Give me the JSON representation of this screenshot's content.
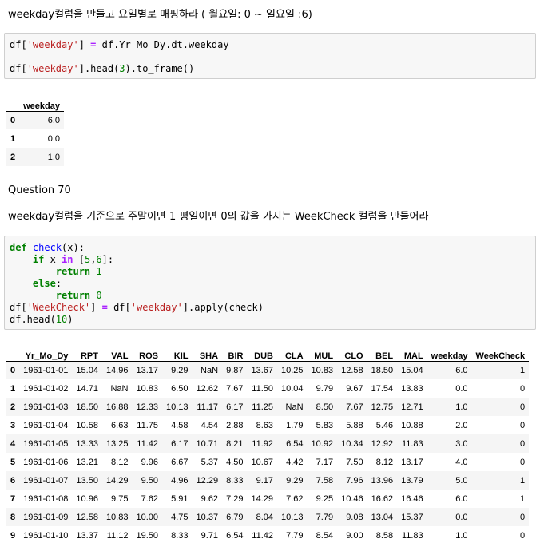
{
  "md1": "weekday컬럼을 만들고 요일별로 매핑하라 ( 월요일: 0 ~ 일요일 :6)",
  "cell1": {
    "line1": [
      {
        "t": "df[",
        "c": ""
      },
      {
        "t": "'weekday'",
        "c": "str"
      },
      {
        "t": "] ",
        "c": ""
      },
      {
        "t": "=",
        "c": "op"
      },
      {
        "t": " df.Yr_Mo_Dy.dt.weekday",
        "c": ""
      }
    ],
    "line2": [
      {
        "t": "df[",
        "c": ""
      },
      {
        "t": "'weekday'",
        "c": "str"
      },
      {
        "t": "].head(",
        "c": ""
      },
      {
        "t": "3",
        "c": "num"
      },
      {
        "t": ").to_frame()",
        "c": ""
      }
    ]
  },
  "table1": {
    "columns": [
      "weekday"
    ],
    "rows": [
      {
        "index": "0",
        "values": [
          "6.0"
        ]
      },
      {
        "index": "1",
        "values": [
          "0.0"
        ]
      },
      {
        "index": "2",
        "values": [
          "1.0"
        ]
      }
    ]
  },
  "question": "Question 70",
  "md2": "weekday컬럼을 기준으로 주말이면 1 평일이면 0의 값을 가지는 WeekCheck 컬럼을 만들어라",
  "cell2": {
    "lines": [
      [
        {
          "t": "def",
          "c": "kw"
        },
        {
          "t": " ",
          "c": ""
        },
        {
          "t": "check",
          "c": "fn"
        },
        {
          "t": "(x):",
          "c": ""
        }
      ],
      [
        {
          "t": "    ",
          "c": ""
        },
        {
          "t": "if",
          "c": "kw"
        },
        {
          "t": " x ",
          "c": ""
        },
        {
          "t": "in",
          "c": "op"
        },
        {
          "t": " [",
          "c": ""
        },
        {
          "t": "5",
          "c": "num"
        },
        {
          "t": ",",
          "c": ""
        },
        {
          "t": "6",
          "c": "num"
        },
        {
          "t": "]:",
          "c": ""
        }
      ],
      [
        {
          "t": "        ",
          "c": ""
        },
        {
          "t": "return",
          "c": "kw"
        },
        {
          "t": " ",
          "c": ""
        },
        {
          "t": "1",
          "c": "num"
        }
      ],
      [
        {
          "t": "    ",
          "c": ""
        },
        {
          "t": "else",
          "c": "kw"
        },
        {
          "t": ":",
          "c": ""
        }
      ],
      [
        {
          "t": "        ",
          "c": ""
        },
        {
          "t": "return",
          "c": "kw"
        },
        {
          "t": " ",
          "c": ""
        },
        {
          "t": "0",
          "c": "num"
        }
      ],
      [
        {
          "t": "df[",
          "c": ""
        },
        {
          "t": "'WeekCheck'",
          "c": "str"
        },
        {
          "t": "] ",
          "c": ""
        },
        {
          "t": "=",
          "c": "op"
        },
        {
          "t": " df[",
          "c": ""
        },
        {
          "t": "'weekday'",
          "c": "str"
        },
        {
          "t": "].apply(check)",
          "c": ""
        }
      ],
      [
        {
          "t": "df.head(",
          "c": ""
        },
        {
          "t": "10",
          "c": "num"
        },
        {
          "t": ")",
          "c": ""
        }
      ]
    ]
  },
  "table2": {
    "columns": [
      "Yr_Mo_Dy",
      "RPT",
      "VAL",
      "ROS",
      "KIL",
      "SHA",
      "BIR",
      "DUB",
      "CLA",
      "MUL",
      "CLO",
      "BEL",
      "MAL",
      "weekday",
      "WeekCheck"
    ],
    "rows": [
      {
        "index": "0",
        "values": [
          "1961-01-01",
          "15.04",
          "14.96",
          "13.17",
          "9.29",
          "NaN",
          "9.87",
          "13.67",
          "10.25",
          "10.83",
          "12.58",
          "18.50",
          "15.04",
          "6.0",
          "1"
        ]
      },
      {
        "index": "1",
        "values": [
          "1961-01-02",
          "14.71",
          "NaN",
          "10.83",
          "6.50",
          "12.62",
          "7.67",
          "11.50",
          "10.04",
          "9.79",
          "9.67",
          "17.54",
          "13.83",
          "0.0",
          "0"
        ]
      },
      {
        "index": "2",
        "values": [
          "1961-01-03",
          "18.50",
          "16.88",
          "12.33",
          "10.13",
          "11.17",
          "6.17",
          "11.25",
          "NaN",
          "8.50",
          "7.67",
          "12.75",
          "12.71",
          "1.0",
          "0"
        ]
      },
      {
        "index": "3",
        "values": [
          "1961-01-04",
          "10.58",
          "6.63",
          "11.75",
          "4.58",
          "4.54",
          "2.88",
          "8.63",
          "1.79",
          "5.83",
          "5.88",
          "5.46",
          "10.88",
          "2.0",
          "0"
        ]
      },
      {
        "index": "4",
        "values": [
          "1961-01-05",
          "13.33",
          "13.25",
          "11.42",
          "6.17",
          "10.71",
          "8.21",
          "11.92",
          "6.54",
          "10.92",
          "10.34",
          "12.92",
          "11.83",
          "3.0",
          "0"
        ]
      },
      {
        "index": "5",
        "values": [
          "1961-01-06",
          "13.21",
          "8.12",
          "9.96",
          "6.67",
          "5.37",
          "4.50",
          "10.67",
          "4.42",
          "7.17",
          "7.50",
          "8.12",
          "13.17",
          "4.0",
          "0"
        ]
      },
      {
        "index": "6",
        "values": [
          "1961-01-07",
          "13.50",
          "14.29",
          "9.50",
          "4.96",
          "12.29",
          "8.33",
          "9.17",
          "9.29",
          "7.58",
          "7.96",
          "13.96",
          "13.79",
          "5.0",
          "1"
        ]
      },
      {
        "index": "7",
        "values": [
          "1961-01-08",
          "10.96",
          "9.75",
          "7.62",
          "5.91",
          "9.62",
          "7.29",
          "14.29",
          "7.62",
          "9.25",
          "10.46",
          "16.62",
          "16.46",
          "6.0",
          "1"
        ]
      },
      {
        "index": "8",
        "values": [
          "1961-01-09",
          "12.58",
          "10.83",
          "10.00",
          "4.75",
          "10.37",
          "6.79",
          "8.04",
          "10.13",
          "7.79",
          "9.08",
          "13.04",
          "15.37",
          "0.0",
          "0"
        ]
      },
      {
        "index": "9",
        "values": [
          "1961-01-10",
          "13.37",
          "11.12",
          "19.50",
          "8.33",
          "9.71",
          "6.54",
          "11.42",
          "7.79",
          "8.54",
          "9.00",
          "8.58",
          "11.83",
          "1.0",
          "0"
        ]
      }
    ]
  }
}
